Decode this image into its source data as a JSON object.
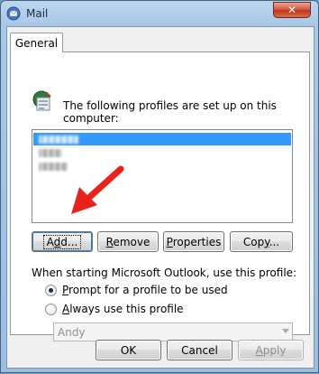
{
  "window": {
    "title": "Mail",
    "close_label": "✕"
  },
  "tabs": [
    {
      "label": "General"
    }
  ],
  "profiles": {
    "label": "The following profiles are set up on this computer:",
    "items": [
      {
        "state": "selected",
        "note": "redacted"
      },
      {
        "state": "normal",
        "note": "redacted"
      },
      {
        "state": "normal",
        "note": "redacted"
      }
    ]
  },
  "profile_buttons": {
    "add": {
      "pre": "A",
      "access": "d",
      "post": "d..."
    },
    "remove": {
      "pre": "",
      "access": "R",
      "post": "emove"
    },
    "properties": {
      "pre": "",
      "access": "P",
      "post": "roperties"
    },
    "copy": {
      "pre": "Cop",
      "access": "y",
      "post": "..."
    }
  },
  "startup": {
    "label": "When starting Microsoft Outlook, use this profile:",
    "option_prompt": {
      "access": "P",
      "rest": "rompt for a profile to be used",
      "checked": true
    },
    "option_always": {
      "access": "A",
      "rest": "lways use this profile",
      "checked": false
    },
    "profile_select_value": "Andy"
  },
  "footer": {
    "ok": "OK",
    "cancel": "Cancel",
    "apply": {
      "access": "A",
      "rest": "pply",
      "disabled": true
    }
  },
  "annotation": {
    "arrow_color": "#e8231b"
  },
  "colors": {
    "selection": "#3399ff",
    "close_button": "#c9452c"
  }
}
